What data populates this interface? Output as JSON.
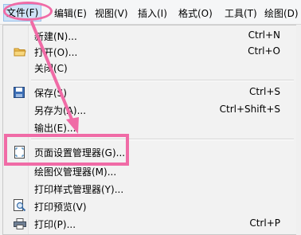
{
  "menubar": {
    "items": [
      {
        "label": "文件(F)",
        "active": true
      },
      {
        "label": "编辑(E)"
      },
      {
        "label": "视图(V)"
      },
      {
        "label": "插入(I)"
      },
      {
        "label": "格式(O)"
      },
      {
        "label": "工具(T)"
      },
      {
        "label": "绘图(D)"
      }
    ]
  },
  "file_menu": {
    "items": [
      {
        "label": "新建(N)...",
        "shortcut": "Ctrl+N",
        "icon": "none"
      },
      {
        "label": "打开(O)...",
        "shortcut": "Ctrl+O",
        "icon": "folder-icon"
      },
      {
        "label": "关闭(C)",
        "shortcut": "",
        "icon": "none"
      },
      {
        "label": "保存(S)",
        "shortcut": "Ctrl+S",
        "icon": "save-icon"
      },
      {
        "label": "另存为(A)...",
        "shortcut": "Ctrl+Shift+S",
        "icon": "none"
      },
      {
        "label": "输出(E)...",
        "shortcut": "",
        "icon": "none"
      },
      {
        "label": "页面设置管理器(G)...",
        "shortcut": "",
        "icon": "page-setup-icon"
      },
      {
        "label": "绘图仪管理器(M)...",
        "shortcut": "",
        "icon": "none"
      },
      {
        "label": "打印样式管理器(Y)...",
        "shortcut": "",
        "icon": "none"
      },
      {
        "label": "打印预览(V)",
        "shortcut": "",
        "icon": "print-preview-icon"
      },
      {
        "label": "打印(P)...",
        "shortcut": "Ctrl+P",
        "icon": "printer-icon"
      }
    ]
  },
  "annotation": {
    "color": "#f06ba6"
  }
}
